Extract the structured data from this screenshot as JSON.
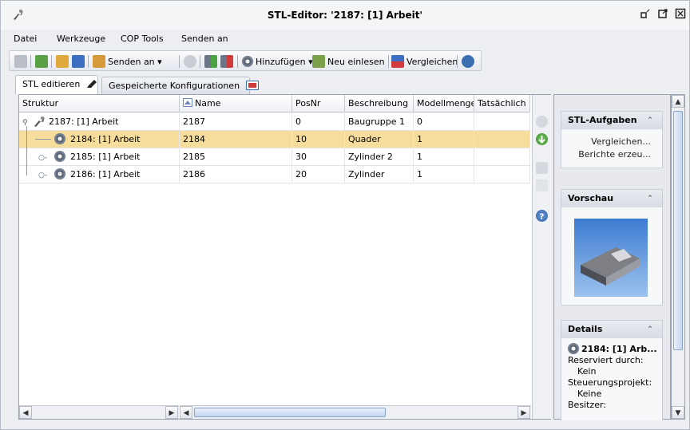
{
  "window": {
    "title": "STL-Editor: '2187: [1] Arbeit'",
    "controls": {
      "minimize": "ᵕ",
      "restore": "◳",
      "close": "☒"
    }
  },
  "menu": [
    {
      "label": "Datei"
    },
    {
      "label": "Werkzeuge"
    },
    {
      "label": "COP Tools"
    },
    {
      "label": "Senden an"
    }
  ],
  "toolbar": {
    "send_to": "Senden an ▾",
    "add": "Hinzufügen ▾",
    "reload": "Neu einlesen",
    "compare": "Vergleichen"
  },
  "tabs": [
    {
      "label": "STL editieren"
    },
    {
      "label": "Gespeicherte Konfigurationen"
    }
  ],
  "grid": {
    "columns": [
      "Struktur",
      "Name",
      "PosNr",
      "Beschreibung",
      "Modellmenge",
      "Tatsächlich"
    ],
    "rows": [
      {
        "struktur": "2187: [1] Arbeit",
        "name": "2187",
        "posnr": "0",
        "beschreibung": "Baugruppe 1",
        "modellmenge": "0",
        "tats": "",
        "level": 0,
        "expander": "⚬",
        "selected": false
      },
      {
        "struktur": "2184: [1] Arbeit",
        "name": "2184",
        "posnr": "10",
        "beschreibung": "Quader",
        "modellmenge": "1",
        "tats": "",
        "level": 1,
        "expander": "",
        "selected": true
      },
      {
        "struktur": "2185: [1] Arbeit",
        "name": "2185",
        "posnr": "30",
        "beschreibung": "Zylinder 2",
        "modellmenge": "1",
        "tats": "",
        "level": 1,
        "expander": "○-",
        "selected": false
      },
      {
        "struktur": "2186: [1] Arbeit",
        "name": "2186",
        "posnr": "20",
        "beschreibung": "Zylinder",
        "modellmenge": "1",
        "tats": "",
        "level": 1,
        "expander": "○-",
        "selected": false
      }
    ]
  },
  "right_panel": {
    "tasks": {
      "title": "STL-Aufgaben",
      "links": [
        "Vergleichen...",
        "Berichte erzeu..."
      ]
    },
    "preview": {
      "title": "Vorschau"
    },
    "details": {
      "title": "Details",
      "item": "2184: [1] Arb...",
      "reserved_label": "Reserviert durch:",
      "reserved_value": "Kein",
      "project_label": "Steuerungsprojekt:",
      "project_value": "Keine",
      "owner_label": "Besitzer:"
    }
  },
  "colors": {
    "selected_row": "#f7dd9c",
    "accent": "#3a6fb0"
  }
}
